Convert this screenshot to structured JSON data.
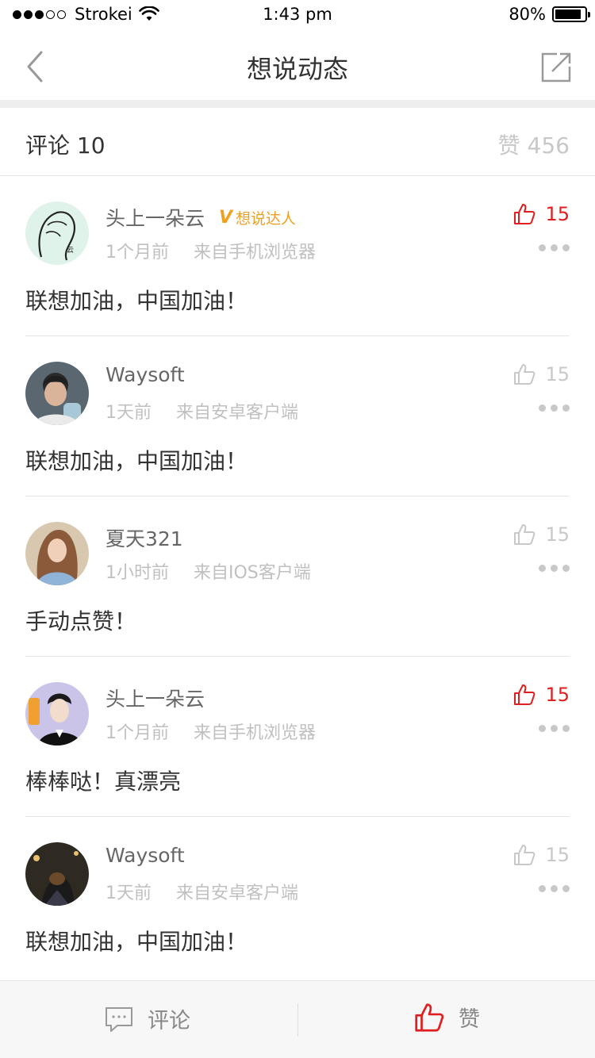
{
  "status_bar": {
    "carrier": "Strokei",
    "time": "1:43 pm",
    "battery": "80%"
  },
  "nav": {
    "title": "想说动态"
  },
  "header": {
    "comments_label": "评论 10",
    "likes_label": "赞 456"
  },
  "colors": {
    "accent_red": "#e02020",
    "badge_orange": "#f0a020",
    "muted": "#c8c8c8"
  },
  "comments": [
    {
      "user": "头上一朵云",
      "badge": "想说达人",
      "time": "1个月前",
      "source": "来自手机浏览器",
      "likes": "15",
      "liked": true,
      "text": "联想加油，中国加油！"
    },
    {
      "user": "Waysoft",
      "time": "1天前",
      "source": "来自安卓客户端",
      "likes": "15",
      "liked": false,
      "text": "联想加油，中国加油！"
    },
    {
      "user": "夏天321",
      "time": "1小时前",
      "source": "来自IOS客户端",
      "likes": "15",
      "liked": false,
      "text": "手动点赞！"
    },
    {
      "user": "头上一朵云",
      "time": "1个月前",
      "source": "来自手机浏览器",
      "likes": "15",
      "liked": true,
      "text": "棒棒哒！真漂亮"
    },
    {
      "user": "Waysoft",
      "time": "1天前",
      "source": "来自安卓客户端",
      "likes": "15",
      "liked": false,
      "text": "联想加油，中国加油！"
    }
  ],
  "bottom_bar": {
    "comment_label": "评论",
    "like_label": "赞"
  }
}
